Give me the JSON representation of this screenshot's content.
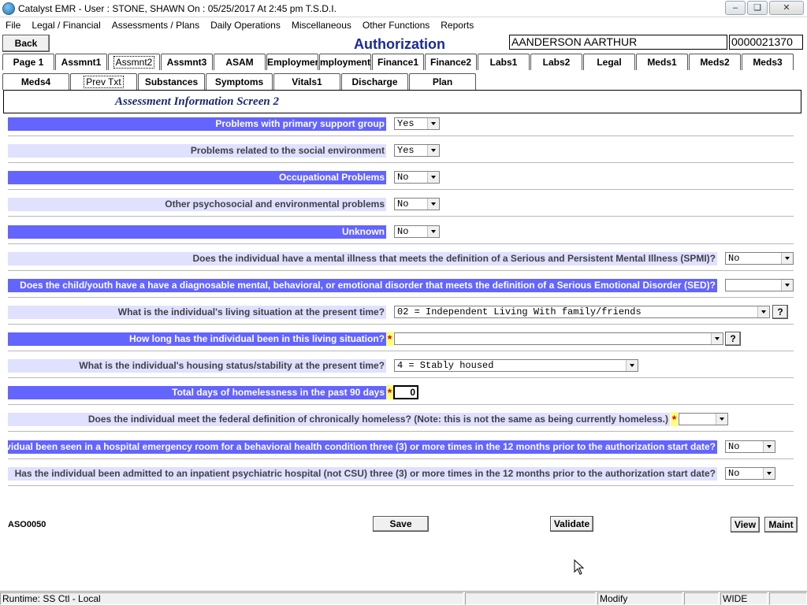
{
  "window": {
    "title": "Catalyst EMR  - User : STONE, SHAWN On : 05/25/2017 At  2:45 pm  T.S.D.I."
  },
  "menu": [
    "File",
    "Legal / Financial",
    "Assessments / Plans",
    "Daily Operations",
    "Miscellaneous",
    "Other Functions",
    "Reports"
  ],
  "header": {
    "back_label": "Back",
    "page_title": "Authorization",
    "patient_name": "AANDERSON AARTHUR",
    "patient_id": "0000021370"
  },
  "tabs_row1": [
    "Page 1",
    "Assmnt1",
    "Assmnt2",
    "Assmnt3",
    "ASAM",
    "Employment",
    "mployment",
    "Finance1",
    "Finance2",
    "Labs1",
    "Labs2",
    "Legal",
    "Meds1",
    "Meds2",
    "Meds3"
  ],
  "tabs_row2": [
    "Meds4",
    "Prev Txt",
    "Substances",
    "Symptoms",
    "Vitals1",
    "Discharge",
    "Plan"
  ],
  "screen_title": "Assessment Information Screen 2",
  "rows": [
    {
      "label": "Problems with primary support group",
      "value": "Yes"
    },
    {
      "label": "Problems related to the social environment",
      "value": "Yes"
    },
    {
      "label": "Occupational Problems",
      "value": "No"
    },
    {
      "label": "Other psychosocial and environmental problems",
      "value": "No"
    },
    {
      "label": "Unknown",
      "value": "No"
    },
    {
      "label": "Does the individual have a mental illness that meets the definition of a Serious and Persistent Mental Illness (SPMI)?",
      "value": "No"
    },
    {
      "label": "Does the child/youth have a have a diagnosable mental, behavioral, or emotional disorder that meets the definition of a Serious Emotional Disorder (SED)?",
      "value": ""
    },
    {
      "label": "What is the individual's living situation at the present time?",
      "value": "02 = Independent Living  With family/friends"
    },
    {
      "label": "How long has the individual been in this living situation?",
      "value": ""
    },
    {
      "label": "What is the individual's housing status/stability at the present time?",
      "value": "4 = Stably housed"
    },
    {
      "label": "Total days of homelessness in the past 90 days",
      "value": "0"
    },
    {
      "label": "Does the individual meet the federal definition of chronically homeless?  (Note:  this is not the same as being currently homeless.)",
      "value": ""
    },
    {
      "label": "Has the individual been seen in a hospital emergency room for a behavioral health condition three (3) or more times in the 12 months prior to the authorization start date?",
      "value": "No"
    },
    {
      "label": "Has the individual been admitted to an inpatient psychiatric hospital (not CSU) three (3) or more times in the 12 months prior to the authorization start date?",
      "value": "No"
    }
  ],
  "help_label": "?",
  "required_marker": "*",
  "footer": {
    "form_code": "ASO0050",
    "save_label": "Save",
    "validate_label": "Validate",
    "view_label": "View",
    "maint_label": "Maint"
  },
  "status": {
    "runtime": "Runtime: SS Ctl - Local",
    "mode": "Modify",
    "layout": "WIDE"
  },
  "colors": {
    "dark_row": "#6464ff",
    "light_row": "#e0e0ff",
    "title": "#1a2a9a",
    "required": "#e00000"
  }
}
